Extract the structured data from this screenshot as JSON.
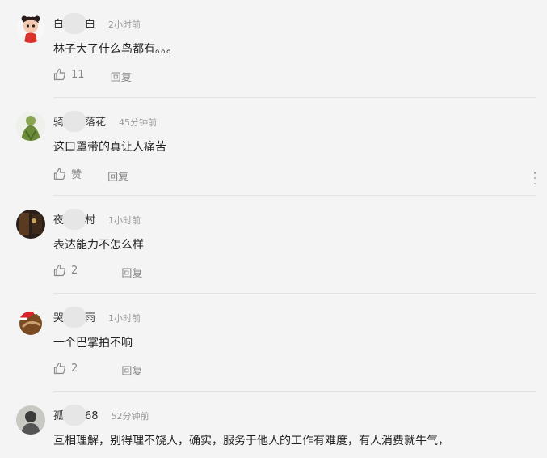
{
  "comments": [
    {
      "name_prefix": "白",
      "name_suffix": "白",
      "time": "2小时前",
      "content": "林子大了什么鸟都有。。。",
      "likes": "11",
      "reply": "回复"
    },
    {
      "name_prefix": "骑",
      "name_suffix": "落花",
      "time": "45分钟前",
      "content": "这口罩带的真让人痛苦",
      "likes": "赞",
      "reply": "回复"
    },
    {
      "name_prefix": "夜",
      "name_suffix": "村",
      "time": "1小时前",
      "content": "表达能力不怎么样",
      "likes": "2",
      "reply": "回复"
    },
    {
      "name_prefix": "哭",
      "name_suffix": "雨",
      "time": "1小时前",
      "content": "一个巴掌拍不响",
      "likes": "2",
      "reply": "回复"
    },
    {
      "name_prefix": "孤",
      "name_suffix": "68",
      "time": "52分钟前",
      "content": "互相理解，别得理不饶人，确实，服务于他人的工作有难度，有人消费就牛气，",
      "likes": "",
      "reply": ""
    }
  ],
  "icons": {
    "like": "thumbs-up-icon",
    "more": "more-vertical-icon"
  }
}
